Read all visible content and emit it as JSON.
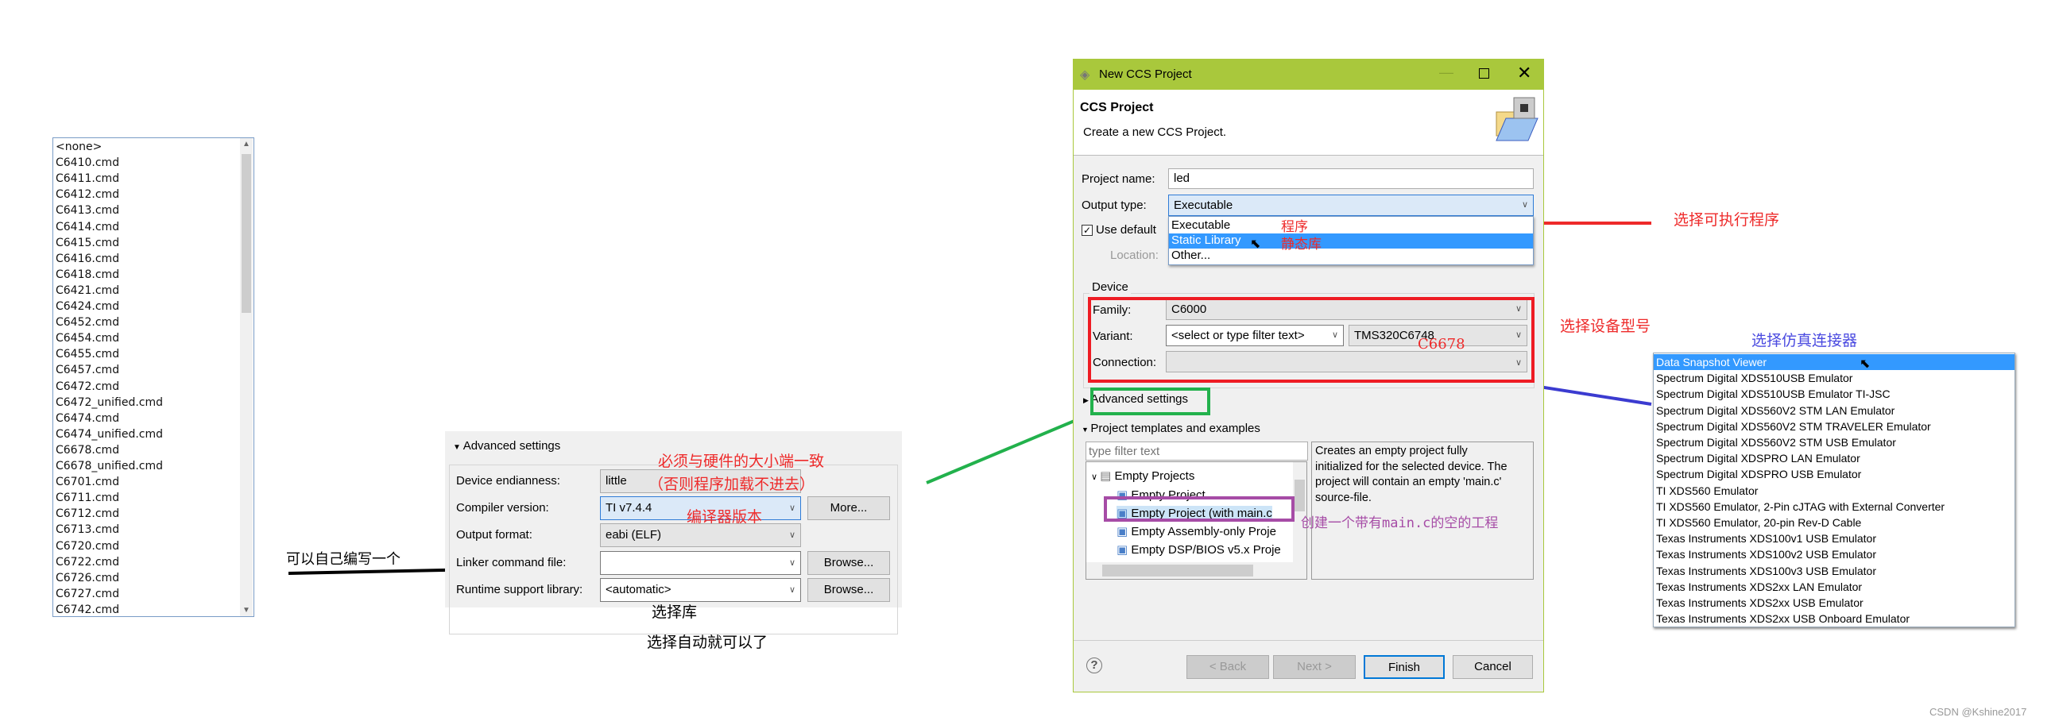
{
  "linker_cmd_list": {
    "items": [
      "<none>",
      "C6410.cmd",
      "C6411.cmd",
      "C6412.cmd",
      "C6413.cmd",
      "C6414.cmd",
      "C6415.cmd",
      "C6416.cmd",
      "C6418.cmd",
      "C6421.cmd",
      "C6424.cmd",
      "C6452.cmd",
      "C6454.cmd",
      "C6455.cmd",
      "C6457.cmd",
      "C6472.cmd",
      "C6472_unified.cmd",
      "C6474.cmd",
      "C6474_unified.cmd",
      "C6678.cmd",
      "C6678_unified.cmd",
      "C6701.cmd",
      "C6711.cmd",
      "C6712.cmd",
      "C6713.cmd",
      "C6720.cmd",
      "C6722.cmd",
      "C6726.cmd",
      "C6727.cmd",
      "C6742.cmd"
    ]
  },
  "advanced_panel": {
    "header": "Advanced settings",
    "endianness_label": "Device endianness:",
    "endianness_value": "little",
    "compiler_label": "Compiler version:",
    "compiler_value": "TI v7.4.4",
    "more_button": "More...",
    "output_format_label": "Output format:",
    "output_format_value": "eabi (ELF)",
    "linker_label": "Linker command file:",
    "linker_value": "",
    "browse_button": "Browse...",
    "runtime_label": "Runtime support library:",
    "runtime_value": "<automatic>"
  },
  "annotations": {
    "write_own": "可以自己编写一个",
    "endian_note_1": "必须与硬件的大小端一致",
    "endian_note_2": "（否则程序加载不进去）",
    "compiler_note": "编译器版本",
    "choose_lib": "选择库",
    "choose_auto": "选择自动就可以了",
    "program": "程序",
    "static_lib": "静态库",
    "c6678": "C6678",
    "choose_exec": "选择可执行程序",
    "choose_device": "选择设备型号",
    "choose_emulator": "选择仿真连接器",
    "empty_main": "创建一个带有main.c的空的工程"
  },
  "dialog": {
    "title": "New CCS Project",
    "heading": "CCS Project",
    "subtitle": "Create a new CCS Project.",
    "project_name_label": "Project name:",
    "project_name_value": "led",
    "output_type_label": "Output type:",
    "output_type_value": "Executable",
    "output_type_options": [
      "Executable",
      "Static Library",
      "Other..."
    ],
    "use_default_label": "Use default",
    "location_label": "Location:",
    "device_group": "Device",
    "family_label": "Family:",
    "family_value": "C6000",
    "variant_label": "Variant:",
    "variant_filter": "<select or type filter text>",
    "variant_value": "TMS320C6748",
    "connection_label": "Connection:",
    "advanced_settings": "Advanced settings",
    "templates_label": "Project templates and examples",
    "filter_placeholder": "type filter text",
    "tree": {
      "group": "Empty Projects",
      "items": [
        "Empty Project",
        "Empty Project (with main.c",
        "Empty Assembly-only Proje",
        "Empty DSP/BIOS v5.x Proje"
      ]
    },
    "description": "Creates an empty project fully initialized for the selected device. The project will contain an empty 'main.c' source-file.",
    "buttons": {
      "back": "< Back",
      "next": "Next >",
      "finish": "Finish",
      "cancel": "Cancel"
    }
  },
  "connection_list": {
    "items": [
      "Data Snapshot Viewer",
      "Spectrum Digital XDS510USB Emulator",
      "Spectrum Digital XDS510USB Emulator TI-JSC",
      "Spectrum Digital XDS560V2 STM LAN Emulator",
      "Spectrum Digital XDS560V2 STM TRAVELER Emulator",
      "Spectrum Digital XDS560V2 STM USB Emulator",
      "Spectrum Digital XDSPRO LAN Emulator",
      "Spectrum Digital XDSPRO USB Emulator",
      "TI XDS560 Emulator",
      "TI XDS560 Emulator, 2-Pin cJTAG with External Converter",
      "TI XDS560 Emulator, 20-pin Rev-D Cable",
      "Texas Instruments XDS100v1 USB Emulator",
      "Texas Instruments XDS100v2 USB Emulator",
      "Texas Instruments XDS100v3 USB Emulator",
      "Texas Instruments XDS2xx LAN Emulator",
      "Texas Instruments XDS2xx USB Emulator",
      "Texas Instruments XDS2xx USB Onboard Emulator"
    ],
    "selected": 0
  },
  "watermark": "CSDN @Kshine2017",
  "colors": {
    "titlebar": "#a9c83c",
    "selection": "#3399ff",
    "annotation_red": "#ee2a2a",
    "annotation_blue": "#4a4ae0",
    "annotation_purple": "#a64ca6",
    "annotation_green": "#22b14c"
  }
}
